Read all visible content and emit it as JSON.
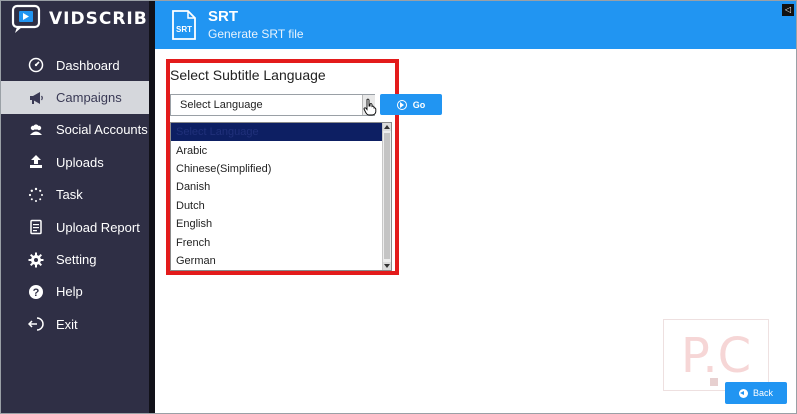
{
  "app": {
    "name": "VIDSCRIBE"
  },
  "sidebar": {
    "items": [
      {
        "label": "Dashboard",
        "icon": "dashboard-gauge-icon",
        "active": false
      },
      {
        "label": "Campaigns",
        "icon": "megaphone-icon",
        "active": true
      },
      {
        "label": "Social Accounts",
        "icon": "users-icon",
        "active": false
      },
      {
        "label": "Uploads",
        "icon": "upload-icon",
        "active": false
      },
      {
        "label": "Task",
        "icon": "spinner-icon",
        "active": false
      },
      {
        "label": "Upload Report",
        "icon": "report-icon",
        "active": false
      },
      {
        "label": "Setting",
        "icon": "gear-icon",
        "active": false
      },
      {
        "label": "Help",
        "icon": "help-icon",
        "active": false
      },
      {
        "label": "Exit",
        "icon": "exit-icon",
        "active": false
      }
    ]
  },
  "header": {
    "icon_text": "SRT",
    "title": "SRT",
    "subtitle": "Generate SRT file",
    "corner_button": "◁"
  },
  "form": {
    "heading": "Select Subtitle Language",
    "select_value": "Select Language",
    "go_label": "Go",
    "options": [
      "Select Language",
      "Arabic",
      "Chinese(Simplified)",
      "Danish",
      "Dutch",
      "English",
      "French",
      "German"
    ],
    "selected_index": 0
  },
  "footer": {
    "back_label": "Back"
  },
  "watermark": {
    "text": "P.C"
  },
  "colors": {
    "sidebar_bg": "#2f2f45",
    "header_bg": "#2195f2",
    "accent": "#2195f2",
    "highlight_border": "#e31b1b",
    "selected_option_bg": "#0d1f63"
  }
}
